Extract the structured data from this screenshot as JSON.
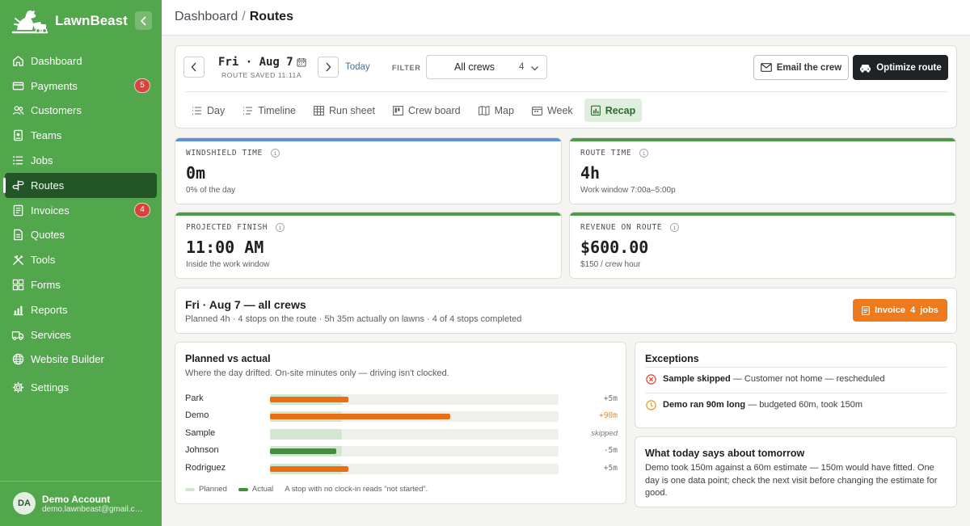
{
  "brand": {
    "name": "LawnBeast"
  },
  "sidebar": {
    "items": [
      {
        "label": "Dashboard",
        "icon": "home-icon"
      },
      {
        "label": "Payments",
        "icon": "credit-card-icon",
        "badge": "5"
      },
      {
        "label": "Customers",
        "icon": "users-icon"
      },
      {
        "label": "Teams",
        "icon": "id-badge-icon"
      },
      {
        "label": "Jobs",
        "icon": "list-icon"
      },
      {
        "label": "Routes",
        "icon": "signpost-icon",
        "active": true
      },
      {
        "label": "Invoices",
        "icon": "receipt-icon",
        "badge": "4"
      },
      {
        "label": "Quotes",
        "icon": "document-icon"
      },
      {
        "label": "Tools",
        "icon": "tools-icon"
      },
      {
        "label": "Forms",
        "icon": "grid-icon"
      },
      {
        "label": "Reports",
        "icon": "bar-chart-icon"
      },
      {
        "label": "Services",
        "icon": "truck-icon"
      },
      {
        "label": "Website Builder",
        "icon": "globe-icon"
      },
      {
        "label": "Settings",
        "icon": "gear-icon"
      }
    ]
  },
  "account": {
    "initials": "DA",
    "name": "Demo Account",
    "email": "demo.lawnbeast@gmail.com"
  },
  "header": {
    "crumb_parent": "Dashboard",
    "crumb_sep": "/",
    "crumb_current": "Routes"
  },
  "route": {
    "date": "Fri · Aug 7",
    "saved": "ROUTE SAVED 11:11A",
    "today_label": "Today",
    "filter_label": "FILTER",
    "crew_select": {
      "value": "All crews",
      "count": "4"
    },
    "email_label": "Email the crew",
    "optimize_label": "Optimize route"
  },
  "tabs": [
    {
      "label": "Day",
      "icon": "list-icon"
    },
    {
      "label": "Timeline",
      "icon": "timeline-icon"
    },
    {
      "label": "Run sheet",
      "icon": "table-icon"
    },
    {
      "label": "Crew board",
      "icon": "board-icon"
    },
    {
      "label": "Map",
      "icon": "map-icon"
    },
    {
      "label": "Week",
      "icon": "calendar-icon"
    },
    {
      "label": "Recap",
      "icon": "recap-icon",
      "active": true
    }
  ],
  "metrics": [
    {
      "label": "WINDSHIELD TIME",
      "value": "0m",
      "sub": "0% of the day",
      "color": "#5b8fe0"
    },
    {
      "label": "ROUTE TIME",
      "value": "4h",
      "sub": "Work window 7:00a–5:00p",
      "color": "#4e9b48"
    },
    {
      "label": "PROJECTED FINISH",
      "value": "11:00 AM",
      "sub": "Inside the work window",
      "color": "#4e9b48"
    },
    {
      "label": "REVENUE ON ROUTE",
      "value": "$600.00",
      "sub": "$150 / crew hour",
      "color": "#4e9b48"
    }
  ],
  "summary": {
    "title": "Fri · Aug 7 — all crews",
    "sub": "Planned 4h · 4 stops on the route · 5h 35m actually on lawns · 4 of 4 stops completed",
    "invoice_label": "Invoice  4  jobs"
  },
  "planned_vs_actual": {
    "title": "Planned vs actual",
    "sub": "Where the day drifted. On-site minutes only — driving isn't clocked.",
    "scale_max_minutes": 240,
    "rows": [
      {
        "name": "Park",
        "planned_min": 60,
        "actual_min": 65,
        "delta": "+5m",
        "status": "over"
      },
      {
        "name": "Demo",
        "planned_min": 60,
        "actual_min": 150,
        "delta": "+90m",
        "status": "hot"
      },
      {
        "name": "Sample",
        "planned_min": 60,
        "actual_min": 0,
        "delta": "skipped",
        "status": "skipped"
      },
      {
        "name": "Johnson",
        "planned_min": 60,
        "actual_min": 55,
        "delta": "-5m",
        "status": "under"
      },
      {
        "name": "Rodriguez",
        "planned_min": 60,
        "actual_min": 65,
        "delta": "+5m",
        "status": "over"
      }
    ],
    "legend": {
      "planned": "Planned",
      "actual": "Actual",
      "note": "A stop with no clock-in reads “not started”."
    },
    "colors": {
      "planned": "#d3e6cf",
      "over": "#e86f16",
      "under": "#3f8f3c"
    }
  },
  "exceptions": {
    "title": "Exceptions",
    "items": [
      {
        "icon": "x-circle-icon",
        "strong": "Sample skipped",
        "text": " — Customer not home — rescheduled"
      },
      {
        "icon": "clock-icon",
        "strong": "Demo ran 90m long",
        "text": " — budgeted 60m, took 150m"
      }
    ]
  },
  "tomorrow": {
    "title": "What today says about tomorrow",
    "body": "Demo took 150m against a 60m estimate — 150m would have fitted. One day is one data point; check the next visit before changing the estimate for good."
  }
}
